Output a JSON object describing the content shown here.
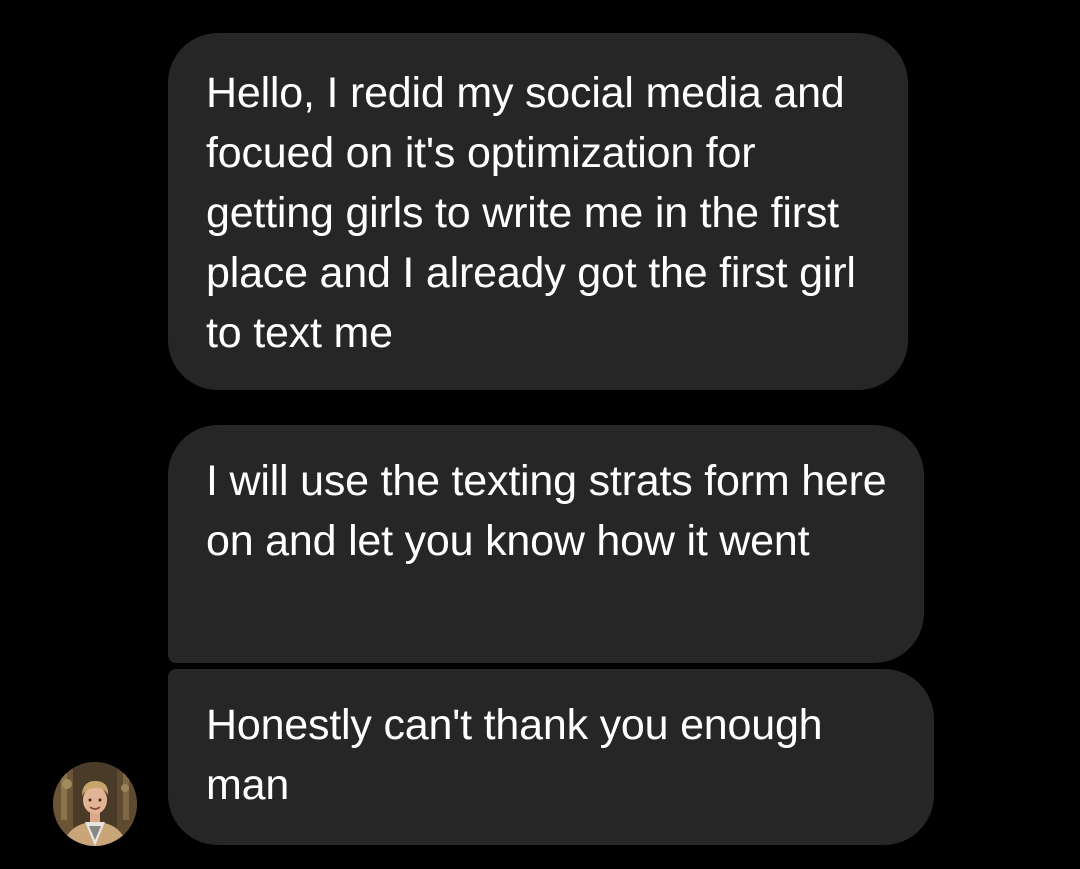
{
  "messages": [
    {
      "text": "Hello, I redid my social media and focued on it's optimization for getting girls to write me in the first place and I already got the first girl to text me"
    },
    {
      "text": "I will use the texting strats form here on and let you know how it went"
    },
    {
      "text": "Honestly can't thank you enough man"
    }
  ],
  "colors": {
    "background": "#000000",
    "bubble": "#262626",
    "text": "#ffffff"
  },
  "sender": {
    "avatar_icon": "profile-photo"
  }
}
